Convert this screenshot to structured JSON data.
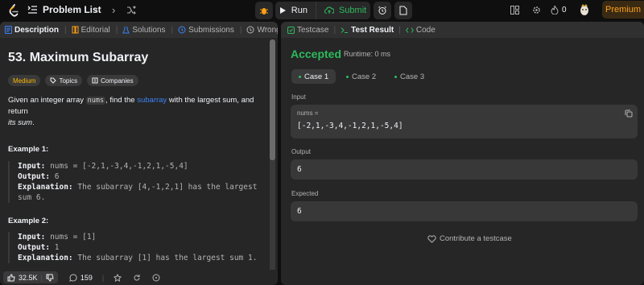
{
  "topbar": {
    "problem_list": "Problem List",
    "run": "Run",
    "submit": "Submit",
    "streak": "0",
    "premium": "Premium"
  },
  "left_tabs": [
    "Description",
    "Editorial",
    "Solutions",
    "Submissions",
    "Wrong Answer"
  ],
  "problem": {
    "title": "53. Maximum Subarray",
    "difficulty": "Medium",
    "topics": "Topics",
    "companies": "Companies",
    "desc_1": "Given an integer array ",
    "desc_code": "nums",
    "desc_2": ", find the ",
    "desc_link": "subarray",
    "desc_3": " with the largest sum, and return",
    "desc_4": "its sum",
    "desc_5": "."
  },
  "examples": [
    {
      "title": "Example 1:",
      "input_k": "Input:",
      "input_v": "nums = [-2,1,-3,4,-1,2,1,-5,4]",
      "output_k": "Output:",
      "output_v": "6",
      "expl_k": "Explanation:",
      "expl_v1": "The subarray [4,-1,2,1] has the largest",
      "expl_v2": "sum 6."
    },
    {
      "title": "Example 2:",
      "input_k": "Input:",
      "input_v": "nums = [1]",
      "output_k": "Output:",
      "output_v": "1",
      "expl_k": "Explanation:",
      "expl_v1": "The subarray [1] has the largest sum 1."
    }
  ],
  "bottom": {
    "likes": "32.5K",
    "comments": "159"
  },
  "right_tabs": [
    "Testcase",
    "Test Result",
    "Code"
  ],
  "result": {
    "status": "Accepted",
    "runtime": "Runtime: 0 ms",
    "cases": [
      "Case 1",
      "Case 2",
      "Case 3"
    ],
    "input_label": "Input",
    "input_var": "nums =",
    "input_val": "[-2,1,-3,4,-1,2,1,-5,4]",
    "output_label": "Output",
    "output_val": "6",
    "expected_label": "Expected",
    "expected_val": "6",
    "contribute": "Contribute a testcase"
  },
  "colors": {
    "accent": "#ffa116",
    "success": "#2cbb5d",
    "link": "#3b82f6",
    "medium": "#ffb800"
  }
}
